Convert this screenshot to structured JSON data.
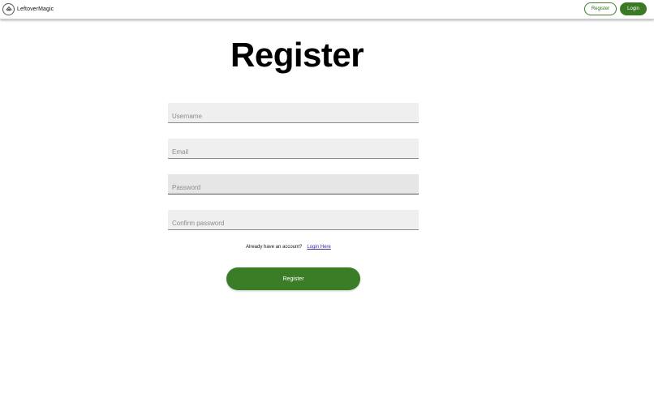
{
  "header": {
    "brand_name": "LeftoverMagic",
    "register_label": "Register",
    "login_label": "Login"
  },
  "form": {
    "title": "Register",
    "username_placeholder": "Username",
    "email_placeholder": "Email",
    "password_placeholder": "Password",
    "confirm_password_placeholder": "Confirm password",
    "have_account_text": "Already have an account?",
    "login_link_label": "Login Here",
    "submit_label": "Register"
  },
  "colors": {
    "accent": "#3b7d27",
    "field_bg": "#efefef",
    "link": "#3a2a9a"
  }
}
